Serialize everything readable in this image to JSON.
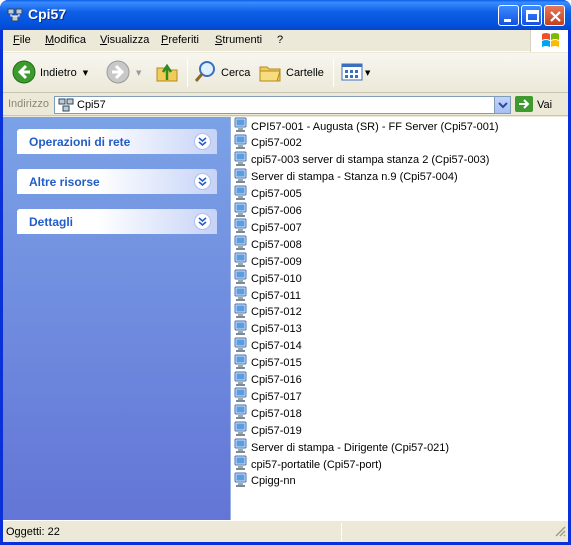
{
  "window": {
    "title": "Cpi57"
  },
  "menu": {
    "items": [
      "File",
      "Modifica",
      "Visualizza",
      "Preferiti",
      "Strumenti",
      "?"
    ]
  },
  "toolbar": {
    "back_label": "Indietro",
    "search_label": "Cerca",
    "folders_label": "Cartelle"
  },
  "address": {
    "label": "Indirizzo",
    "value": "Cpi57",
    "go_label": "Vai"
  },
  "taskpane": {
    "panels": [
      "Operazioni di rete",
      "Altre risorse",
      "Dettagli"
    ]
  },
  "files": [
    "CPI57-001 - Augusta (SR) - FF Server (Cpi57-001)",
    "Cpi57-002",
    "cpi57-003 server di stampa stanza 2 (Cpi57-003)",
    "Server di stampa - Stanza n.9 (Cpi57-004)",
    "Cpi57-005",
    "Cpi57-006",
    "Cpi57-007",
    "Cpi57-008",
    "Cpi57-009",
    "Cpi57-010",
    "Cpi57-011",
    "Cpi57-012",
    "Cpi57-013",
    "Cpi57-014",
    "Cpi57-015",
    "Cpi57-016",
    "Cpi57-017",
    "Cpi57-018",
    "Cpi57-019",
    "Server di stampa - Dirigente (Cpi57-021)",
    "cpi57-portatile (Cpi57-port)",
    "Cpigg-nn"
  ],
  "status": {
    "text": "Oggetti: 22"
  },
  "icons": {
    "computer": "network-computer-icon",
    "back": "back-arrow-icon",
    "forward": "forward-arrow-icon",
    "up": "folder-up-icon",
    "search": "search-icon",
    "folders": "folders-icon",
    "views": "views-icon",
    "go": "go-arrow-icon"
  },
  "colors": {
    "title_bar": "#0251dc",
    "task_pane": "#6f8fe0",
    "panel_title": "#215dc6",
    "frame": "#ece9d8"
  }
}
